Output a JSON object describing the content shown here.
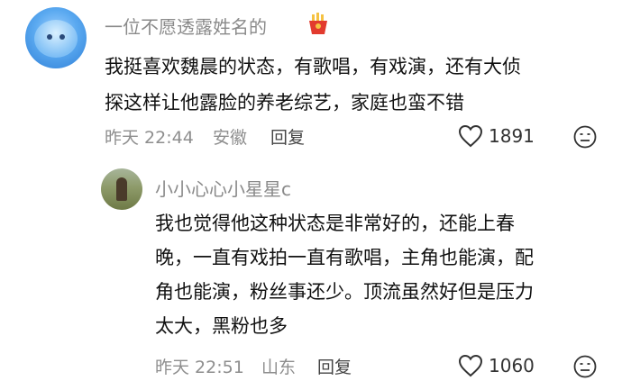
{
  "comment": {
    "username": "一位不愿透露姓名的",
    "text_line1": "我挺喜欢魏晨的状态，有歌唱，有戏演，还有大侦",
    "text_line2": "探这样让他露脸的养老综艺，家庭也蛮不错",
    "time": "昨天 22:44",
    "location": "安徽",
    "reply_label": "回复",
    "likes": "1891",
    "badge_icon": "fries-icon"
  },
  "reply": {
    "username": "小小心心小星星c",
    "text_line1": "我也觉得他这种状态是非常好的，还能上春",
    "text_line2": "晚，一直有戏拍一直有歌唱，主角也能演，配",
    "text_line3": "角也能演，粉丝事还少。顶流虽然好但是压力",
    "text_line4": "太大，黑粉也多",
    "time": "昨天 22:51",
    "location": "山东",
    "reply_label": "回复",
    "likes": "1060"
  }
}
